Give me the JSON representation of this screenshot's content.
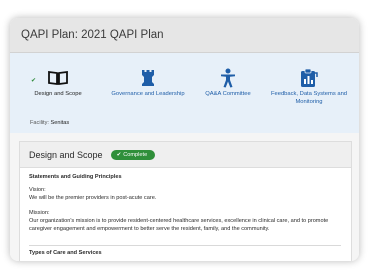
{
  "window": {
    "title": "QAPI Plan: 2021 QAPI Plan"
  },
  "tabs": [
    {
      "label": "Design and Scope",
      "icon": "book-icon",
      "active": true
    },
    {
      "label": "Governance and Leadership",
      "icon": "chess-rook-icon",
      "active": false
    },
    {
      "label": "QA&A Committee",
      "icon": "person-icon",
      "active": false
    },
    {
      "label": "Feedback, Data Systems and Monitoring",
      "icon": "clipboard-chart-icon",
      "active": false
    }
  ],
  "facility": {
    "label": "Facility:",
    "value": "Senitas"
  },
  "card": {
    "title": "Design and Scope",
    "status": "Complete"
  },
  "statements": {
    "title": "Statements and Guiding Principles",
    "vision_label": "Vision:",
    "vision_text": "We will be the premier providers in post-acute care.",
    "mission_label": "Mission:",
    "mission_text_line1": "Our organization's mission is to provide resident-centered healthcare services, excellence in clinical care, and to promote",
    "mission_text_line2": "caregiver engagement and empowerment to better serve the resident, family, and the community."
  },
  "types": {
    "title": "Types of Care and Services"
  },
  "colors": {
    "accent": "#1f5ea8",
    "tab_bg": "#e7f0f9",
    "complete": "#2f8f3a"
  }
}
